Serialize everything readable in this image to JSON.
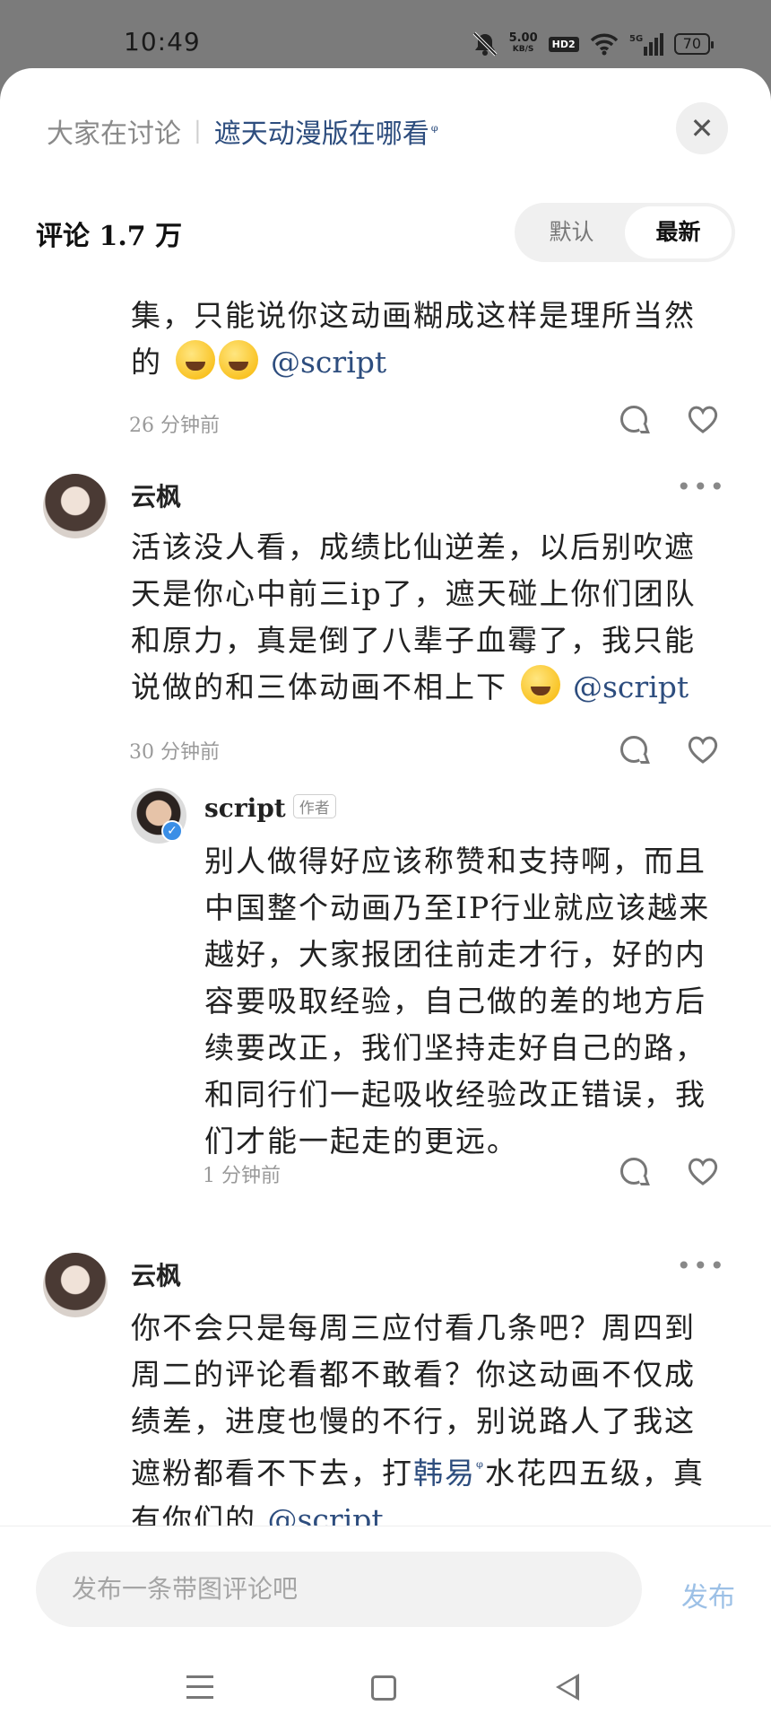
{
  "status_bar": {
    "time": "10:49",
    "net_speed": "5.00",
    "net_unit": "KB/S",
    "hd": "HD2",
    "network": "5G",
    "battery": "70"
  },
  "header": {
    "discussing_label": "大家在讨论",
    "topic_link": "遮天动漫版在哪看",
    "close_icon": "close-icon"
  },
  "comments_header": {
    "title": "评论 1.7 万",
    "sort_default": "默认",
    "sort_latest": "最新",
    "active_sort": "最新"
  },
  "comments": [
    {
      "text": "集，只能说你这动画糊成这样是理所当然的",
      "emoji_count": 2,
      "mention": "@script",
      "time": "26 分钟前"
    },
    {
      "author": "云枫",
      "text": "活该没人看，成绩比仙逆差，以后别吹遮天是你心中前三ip了，遮天碰上你们团队和原力，真是倒了八辈子血霉了，我只能说做的和三体动画不相上下",
      "mention": "@script",
      "time": "30 分钟前",
      "reply": {
        "author": "script",
        "tag": "作者",
        "text": "别人做得好应该称赞和支持啊，而且中国整个动画乃至IP行业就应该越来越好，大家报团往前走才行，好的内容要吸取经验，自己做的差的地方后续要改正，我们坚持走好自己的路，和同行们一起吸收经验改正错误，我们才能一起走的更远。",
        "time": "1 分钟前"
      }
    },
    {
      "author": "云枫",
      "text_before_link": "你不会只是每周三应付看几条吧？周四到周二的评论看都不敢看？你这动画不仅成绩差，进度也慢的不行，别说路人了我这遮粉都看不下去，打",
      "link": "韩易",
      "text_after_link": "水花四五级，真有你们的",
      "mention": "@script"
    }
  ],
  "input_bar": {
    "placeholder": "发布一条带图评论吧",
    "publish": "发布"
  }
}
